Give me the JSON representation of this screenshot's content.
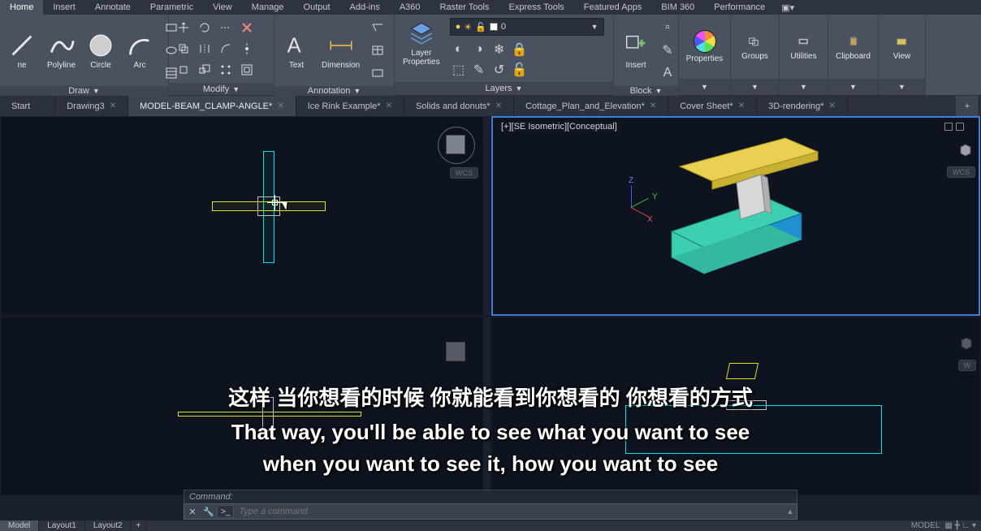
{
  "ribbon_tabs": [
    "Home",
    "Insert",
    "Annotate",
    "Parametric",
    "View",
    "Manage",
    "Output",
    "Add-ins",
    "A360",
    "Raster Tools",
    "Express Tools",
    "Featured Apps",
    "BIM 360",
    "Performance"
  ],
  "ribbon_active": "Home",
  "panels": {
    "draw": {
      "title": "Draw",
      "line": "ne",
      "polyline": "Polyline",
      "circle": "Circle",
      "arc": "Arc"
    },
    "modify": {
      "title": "Modify"
    },
    "annotation": {
      "title": "Annotation",
      "text": "Text",
      "dimension": "Dimension"
    },
    "layers": {
      "title": "Layers",
      "layer_props": "Layer\nProperties",
      "current_layer": "0"
    },
    "block": {
      "title": "Block",
      "insert": "Insert"
    },
    "properties": {
      "title": "Properties"
    },
    "groups": {
      "title": "Groups"
    },
    "utilities": {
      "title": "Utilities"
    },
    "clipboard": {
      "title": "Clipboard"
    },
    "view": {
      "title": "View"
    }
  },
  "doc_tabs": {
    "start": "Start",
    "items": [
      {
        "label": "Drawing3",
        "dirty": false
      },
      {
        "label": "MODEL-BEAM_CLAMP-ANGLE*",
        "dirty": true,
        "active": true
      },
      {
        "label": "Ice Rink Example*",
        "dirty": true
      },
      {
        "label": "Solids and donuts*",
        "dirty": true
      },
      {
        "label": "Cottage_Plan_and_Elevation*",
        "dirty": true
      },
      {
        "label": "Cover Sheet*",
        "dirty": true
      },
      {
        "label": "3D-rendering*",
        "dirty": true
      }
    ]
  },
  "viewport": {
    "tr_label": "[+][SE Isometric][Conceptual]",
    "wcs": "WCS"
  },
  "command": {
    "history": "Command:",
    "placeholder": "Type a command",
    "prompt": ">_"
  },
  "status": {
    "model": "Model",
    "layouts": [
      "Layout1",
      "Layout2"
    ],
    "right_model": "MODEL"
  },
  "subtitles": {
    "cn": "这样 当你想看的时候 你就能看到你想看的 你想看的方式",
    "en1": "That way, you'll be able to see what you want to see",
    "en2": "when you want to see it, how you want to see"
  }
}
